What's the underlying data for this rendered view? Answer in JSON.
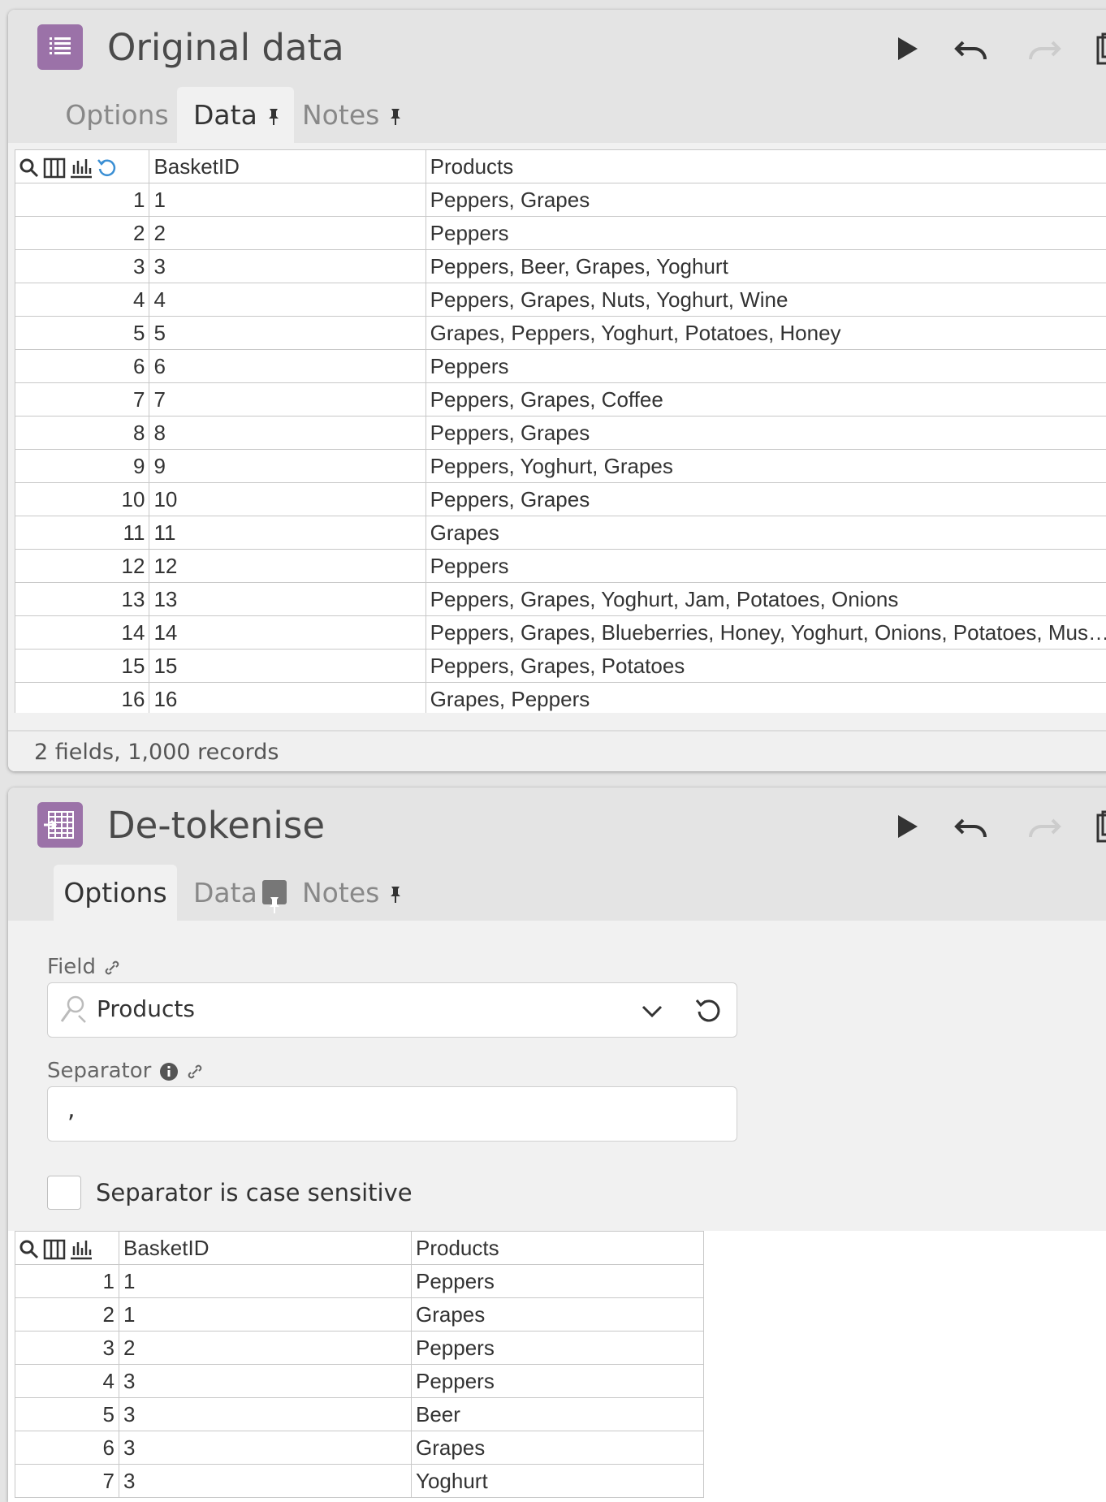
{
  "panel1": {
    "title": "Original data",
    "tabs": [
      {
        "label": "Options",
        "active": false
      },
      {
        "label": "Data",
        "active": true
      },
      {
        "label": "Notes",
        "active": false
      }
    ],
    "grid": {
      "columns": [
        "BasketID",
        "Products"
      ],
      "rows": [
        [
          "1",
          "1",
          "Peppers, Grapes"
        ],
        [
          "2",
          "2",
          "Peppers"
        ],
        [
          "3",
          "3",
          "Peppers, Beer, Grapes, Yoghurt"
        ],
        [
          "4",
          "4",
          "Peppers, Grapes, Nuts, Yoghurt, Wine"
        ],
        [
          "5",
          "5",
          "Grapes, Peppers, Yoghurt, Potatoes, Honey"
        ],
        [
          "6",
          "6",
          "Peppers"
        ],
        [
          "7",
          "7",
          "Peppers, Grapes, Coffee"
        ],
        [
          "8",
          "8",
          "Peppers, Grapes"
        ],
        [
          "9",
          "9",
          "Peppers, Yoghurt, Grapes"
        ],
        [
          "10",
          "10",
          "Peppers, Grapes"
        ],
        [
          "11",
          "11",
          "Grapes"
        ],
        [
          "12",
          "12",
          "Peppers"
        ],
        [
          "13",
          "13",
          "Peppers, Grapes, Yoghurt, Jam, Potatoes, Onions"
        ],
        [
          "14",
          "14",
          "Peppers, Grapes, Blueberries, Honey, Yoghurt, Onions, Potatoes, Mus…"
        ],
        [
          "15",
          "15",
          "Peppers, Grapes, Potatoes"
        ],
        [
          "16",
          "16",
          "Grapes, Peppers"
        ]
      ]
    },
    "status": "2 fields, 1,000 records"
  },
  "panel2": {
    "title": "De-tokenise",
    "tabs": [
      {
        "label": "Options",
        "active": true
      },
      {
        "label": "Data",
        "active": false
      },
      {
        "label": "Notes",
        "active": false
      }
    ],
    "field_label": "Field",
    "field_value": "Products",
    "separator_label": "Separator",
    "separator_value": ",",
    "case_sensitive_label": "Separator is case sensitive",
    "case_sensitive_checked": false,
    "grid": {
      "columns": [
        "BasketID",
        "Products"
      ],
      "rows": [
        [
          "1",
          "1",
          "Peppers"
        ],
        [
          "2",
          "1",
          "Grapes"
        ],
        [
          "3",
          "2",
          "Peppers"
        ],
        [
          "4",
          "3",
          "Peppers"
        ],
        [
          "5",
          "3",
          "Beer"
        ],
        [
          "6",
          "3",
          "Grapes"
        ],
        [
          "7",
          "3",
          "Yoghurt"
        ]
      ]
    }
  },
  "colors": {
    "node_icon": "#9b72a8",
    "refresh_icon": "#3b8fd4",
    "header_bg": "#e4e4e4",
    "body_bg": "#f1f1f1"
  },
  "icons": [
    "list-icon",
    "detokenise-icon",
    "play-icon",
    "undo-icon",
    "redo-icon",
    "copy-icon",
    "pin-icon",
    "search-icon",
    "columns-icon",
    "chart-icon",
    "refresh-icon",
    "chevron-down-icon",
    "reset-icon",
    "info-icon",
    "link-icon",
    "field-icon"
  ]
}
